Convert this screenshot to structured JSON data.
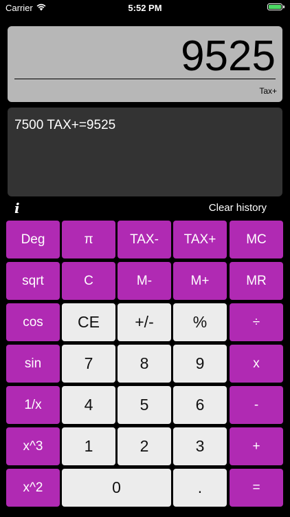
{
  "status_bar": {
    "carrier": "Carrier",
    "time": "5:52 PM"
  },
  "display": {
    "value": "9525",
    "mode": "Tax+"
  },
  "history": {
    "lines": [
      "7500 TAX+=9525"
    ]
  },
  "controls": {
    "info_label": "i",
    "clear_history_label": "Clear history"
  },
  "keys": {
    "deg": "Deg",
    "pi": "π",
    "tax_minus": "TAX-",
    "tax_plus": "TAX+",
    "mc": "MC",
    "sqrt": "sqrt",
    "c": "C",
    "m_minus": "M-",
    "m_plus": "M+",
    "mr": "MR",
    "cos": "cos",
    "ce": "CE",
    "plus_minus": "+/-",
    "percent": "%",
    "divide": "÷",
    "sin": "sin",
    "seven": "7",
    "eight": "8",
    "nine": "9",
    "multiply": "x",
    "reciprocal": "1/x",
    "four": "4",
    "five": "5",
    "six": "6",
    "minus": "-",
    "cube": "x^3",
    "one": "1",
    "two": "2",
    "three": "3",
    "plus": "+",
    "square": "x^2",
    "zero": "0",
    "decimal": ".",
    "equals": "="
  },
  "colors": {
    "function_key": "#b02ab3",
    "digit_key": "#ececec",
    "display_bg": "#b7b7b7",
    "history_bg": "#333333",
    "battery": "#4cd964"
  }
}
